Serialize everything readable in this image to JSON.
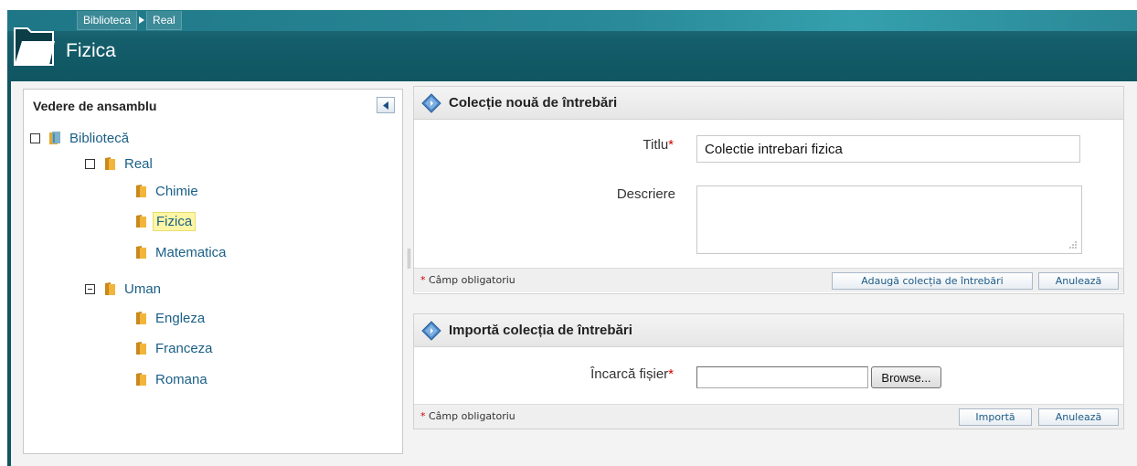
{
  "header": {
    "breadcrumb": [
      "Biblioteca",
      "Real"
    ],
    "title": "Fizica",
    "colors": {
      "bar": "#155e6b",
      "bar_light": "#2a8a99"
    }
  },
  "sidebar": {
    "title": "Vedere de ansamblu",
    "tree": {
      "root": "Bibliotecă",
      "real": "Real",
      "chimie": "Chimie",
      "fizica": "Fizica",
      "matematica": "Matematica",
      "uman": "Uman",
      "engleza": "Engleza",
      "franceza": "Franceza",
      "romana": "Romana"
    }
  },
  "new_collection": {
    "title": "Colecție nouă de întrebări",
    "title_label": "Titlu",
    "required_mark": "*",
    "title_value": "Colectie intrebari fizica",
    "description_label": "Descriere",
    "description_value": "",
    "required_note": "Câmp obligatoriu",
    "add_button": "Adaugă colecția de întrebări",
    "cancel_button": "Anulează"
  },
  "import_collection": {
    "title": "Importă colecția de întrebări",
    "file_label": "Încarcă fișier",
    "required_mark": "*",
    "browse_button": "Browse...",
    "required_note": "Câmp obligatoriu",
    "import_button": "Importă",
    "cancel_button": "Anulează"
  }
}
